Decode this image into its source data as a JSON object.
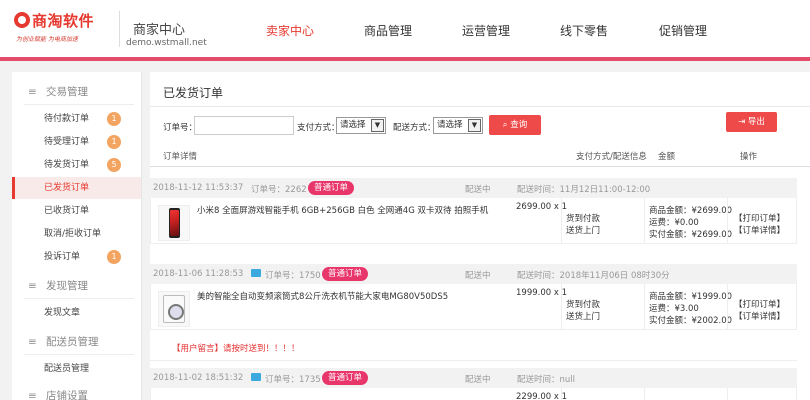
{
  "header": {
    "logo_name": "商淘软件",
    "logo_slogan": "为创业赋能  为电商加速",
    "site_title": "商家中心",
    "site_domain": "demo.wstmall.net",
    "nav": [
      {
        "label": "卖家中心",
        "active": true
      },
      {
        "label": "商品管理",
        "active": false
      },
      {
        "label": "运营管理",
        "active": false
      },
      {
        "label": "线下零售",
        "active": false
      },
      {
        "label": "促销管理",
        "active": false
      }
    ]
  },
  "sidebar": {
    "groups": [
      {
        "label": "交易管理",
        "icon": "menu-icon"
      },
      {
        "label": "发现管理",
        "icon": "menu-icon"
      },
      {
        "label": "配送员管理",
        "icon": "menu-icon"
      },
      {
        "label": "店铺设置",
        "icon": "menu-icon"
      }
    ],
    "items": [
      {
        "label": "待付款订单",
        "badge": "1"
      },
      {
        "label": "待受理订单",
        "badge": "1"
      },
      {
        "label": "待发货订单",
        "badge": "5"
      },
      {
        "label": "已发货订单",
        "badge": "",
        "active": true
      },
      {
        "label": "已收货订单",
        "badge": ""
      },
      {
        "label": "取消/拒收订单",
        "badge": ""
      },
      {
        "label": "投诉订单",
        "badge": "1"
      },
      {
        "label": "发现文章",
        "badge": ""
      },
      {
        "label": "配送员管理",
        "badge": ""
      }
    ]
  },
  "main": {
    "title": "已发货订单",
    "filters": {
      "order_no_label": "订单号：",
      "order_no_value": "",
      "pay_method_label": "支付方式：",
      "pay_method_value": "请选择",
      "delivery_label": "配送方式：",
      "delivery_value": "请选择",
      "search_label": "查询",
      "export_label": "导出"
    },
    "columns": [
      "订单详情",
      "支付方式/配送信息",
      "金额",
      "操作"
    ],
    "orders": [
      {
        "time": "2018-11-12 11:53:37",
        "order_no": "订单号：2262",
        "tag": "普通订单",
        "status": "配送中",
        "delivery_time": "配送时间：11月12日11:00-12:00",
        "product": "小米8 全面屏游戏智能手机 6GB+256GB 白色 全网通4G 双卡双待 拍照手机",
        "price": "2699.00 x 1",
        "pay": "货到付款",
        "delivery": "送货上门",
        "goods_amount": "商品金额：¥2699.00",
        "freight": "运费：¥0.00",
        "paid": "实付金额：¥2699.00",
        "print": "【打印订单】",
        "detail": "【订单详情】",
        "has_pc_icon": false
      },
      {
        "time": "2018-11-06 11:28:53",
        "order_no": "订单号：1750",
        "tag": "普通订单",
        "status": "配送中",
        "delivery_time": "配送时间：2018年11月06日 08时30分",
        "product": "美的智能全自动变频滚筒式8公斤洗衣机节能大家电MG80V50DS5",
        "price": "1999.00 x 1",
        "pay": "货到付款",
        "delivery": "送货上门",
        "goods_amount": "商品金额：¥1999.00",
        "freight": "运费：¥3.00",
        "paid": "实付金额：¥2002.00",
        "print": "【打印订单】",
        "detail": "【订单详情】",
        "message": "【用户留言】请按时送到！！！！",
        "has_pc_icon": true
      },
      {
        "time": "2018-11-02 18:51:32",
        "order_no": "订单号：1735",
        "tag": "普通订单",
        "status": "配送中",
        "delivery_time": "配送时间：null",
        "price": "2299.00 x 1",
        "has_pc_icon": true
      }
    ]
  },
  "colors": {
    "accent": "#e6392f",
    "header_line": "#e54b6b",
    "tag": "#e8366b",
    "badge": "#f3a461",
    "button": "#ee4a4a"
  }
}
